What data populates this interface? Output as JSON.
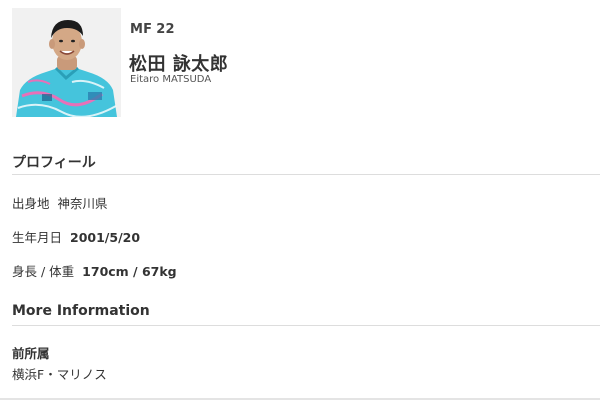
{
  "player": {
    "position": "MF",
    "number": "22",
    "name_ja": "松田 詠太郎",
    "name_en": "Eitaro MATSUDA"
  },
  "profile": {
    "title": "プロフィール",
    "birthplace_label": "出身地",
    "birthplace_value": "神奈川県",
    "birthdate_label": "生年月日",
    "birthdate_value": "2001/5/20",
    "height_weight_label": "身長 / 体重",
    "height_weight_value": "170cm / 67kg"
  },
  "more_info": {
    "title": "More Information",
    "previous_club_label": "前所属",
    "previous_club_value": "横浜F・マリノス"
  },
  "colors": {
    "jersey": "#3fc6de",
    "jersey_accent": "#e86fb6"
  }
}
